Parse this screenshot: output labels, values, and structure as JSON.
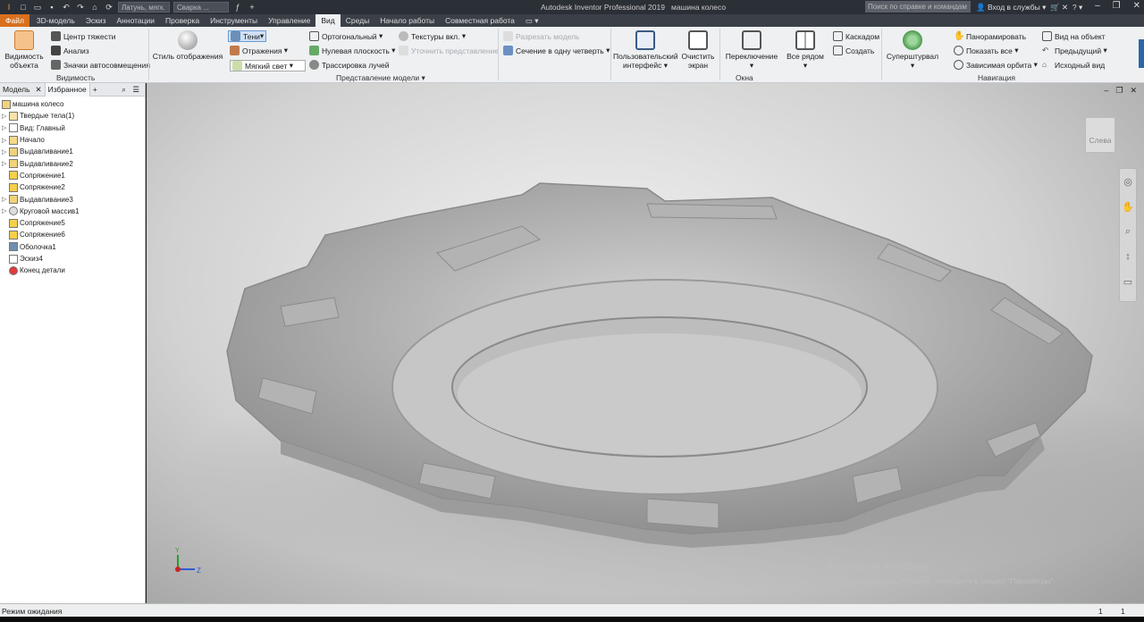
{
  "titlebar": {
    "material": "Латунь, мягк.",
    "appearance": "Сварка ...",
    "title": "Autodesk Inventor Professional 2019",
    "document": "машина колесо",
    "search_placeholder": "Поиск по справке и командам",
    "signin": "Вход в службы"
  },
  "tabs": [
    "Файл",
    "3D-модель",
    "Эскиз",
    "Аннотации",
    "Проверка",
    "Инструменты",
    "Управление",
    "Вид",
    "Среды",
    "Начало работы",
    "Совместная работа"
  ],
  "ribbon": {
    "visibility": {
      "big": "Видимость объекта",
      "center": "Центр тяжести",
      "analysis": "Анализ",
      "dof": "Значки автосовмещения",
      "group": "Видимость"
    },
    "appearance": {
      "style": "Стиль отображения",
      "shadows": "Тени",
      "reflections": "Отражения",
      "light": "Мягкий свет",
      "ortho": "Ортогональный",
      "groundplane": "Нулевая плоскость",
      "raytracing": "Трассировка лучей",
      "textures": "Текстуры вкл.",
      "refine": "Уточнить представление",
      "split": "Разрезать модель",
      "quarter": "Сечение в одну четверть",
      "group": "Представление модели"
    },
    "windows": {
      "ui": "Пользовательский интерфейс",
      "clean": "Очистить экран",
      "switch": "Переключение",
      "arrange": "Все рядом",
      "cascade": "Каскадом",
      "new": "Создать",
      "group": "Окна"
    },
    "navigate": {
      "full": "Суперштурвал",
      "pan": "Панорамировать",
      "zoomall": "Показать все",
      "orbit": "Зависимая орбита",
      "lookat": "Вид на объект",
      "previous": "Предыдущий",
      "home": "Исходный вид",
      "group": "Навигация"
    }
  },
  "browser": {
    "tab_model": "Модель",
    "tab_fav": "Избранное",
    "items": [
      "машина колесо",
      "Твердые тела(1)",
      "Вид: Главный",
      "Начало",
      "Выдавливание1",
      "Выдавливание2",
      "Сопряжение1",
      "Сопряжение2",
      "Выдавливание3",
      "Круговой массив1",
      "Сопряжение5",
      "Сопряжение6",
      "Оболочка1",
      "Эскиз4",
      "Конец детали"
    ]
  },
  "viewport": {
    "viewcube_face": "Слева",
    "axis_y": "Y",
    "axis_z": "Z",
    "activation_title": "Активация Windows",
    "activation_text": "Чтобы активировать Windows, перейдите в раздел \"Параметры\"."
  },
  "status": {
    "message": "Режим ожидания",
    "count1": "1",
    "count2": "1"
  },
  "colors": {
    "file_tab": "#d9701e",
    "titlebar": "#2b2f36",
    "ribbon": "#eef0f2"
  }
}
